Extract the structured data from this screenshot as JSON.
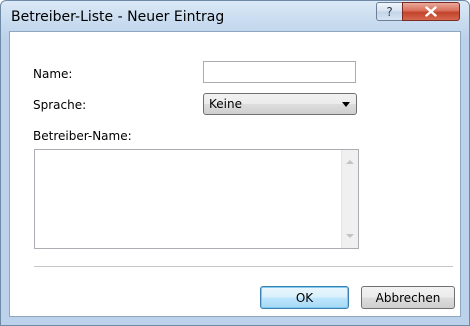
{
  "window": {
    "title": "Betreiber-Liste - Neuer Eintrag",
    "help_glyph": "?",
    "close_icon": "close-icon"
  },
  "form": {
    "name_label": "Name:",
    "name_value": "",
    "language_label": "Sprache:",
    "language_selected": "Keine",
    "operator_label": "Betreiber-Name:",
    "operator_value": ""
  },
  "buttons": {
    "ok_label": "OK",
    "cancel_label": "Abbrechen"
  },
  "colors": {
    "title_frame": "#bcd2ea",
    "close_button": "#c2432c",
    "default_button_border": "#3c7fb1"
  }
}
